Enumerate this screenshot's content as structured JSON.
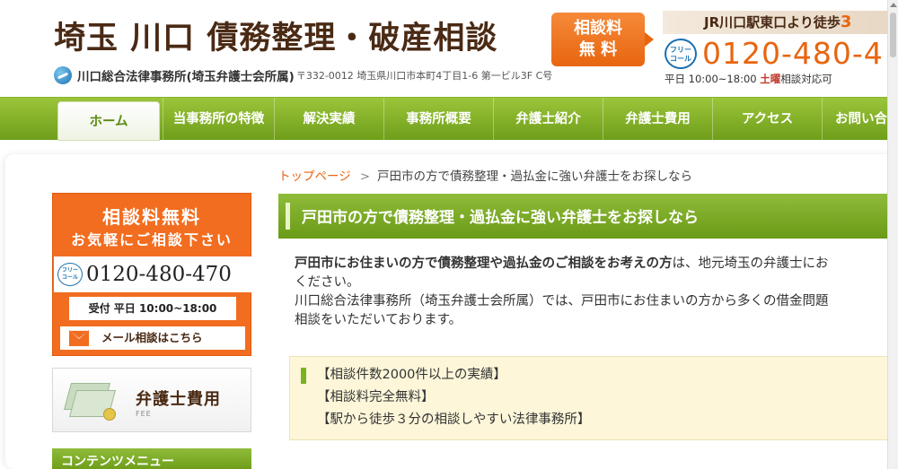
{
  "header": {
    "site_title": "埼玉 川口 債務整理・破産相談",
    "firm_name": "川口総合法律事務所(埼玉弁護士会所属)",
    "firm_address": "〒332-0012 埼玉県川口市本町4丁目1-6 第一ビル3F C号",
    "badge_line1": "相談料",
    "badge_line2": "無 料",
    "station_text": "JR川口駅東口より徒歩",
    "station_minutes": "3",
    "freecall_line1": "フリー",
    "freecall_line2": "コール",
    "phone": "0120-480-4",
    "hours_prefix": "平日 10:00~18:00 ",
    "hours_sat": "土曜",
    "hours_suffix": "相談対応可"
  },
  "nav": {
    "items": [
      {
        "label": "ホーム",
        "active": true
      },
      {
        "label": "当事務所の特徴"
      },
      {
        "label": "解決実績"
      },
      {
        "label": "事務所概要"
      },
      {
        "label": "弁護士紹介"
      },
      {
        "label": "弁護士費用"
      },
      {
        "label": "アクセス"
      },
      {
        "label": "お問い合"
      }
    ]
  },
  "sidebar": {
    "consult_title": "相談料無料",
    "consult_sub": "お気軽にご相談下さい",
    "consult_phone": "0120-480-470",
    "freecall_line1": "フリー",
    "freecall_line2": "コール",
    "consult_hours": "受付 平日 10:00~18:00",
    "mail_label": "メール相談はこちら",
    "fee_title": "弁護士費用",
    "fee_sub": "FEE",
    "menu_title": "コンテンツメニュー"
  },
  "breadcrumb": {
    "home": "トップページ",
    "separator": ">",
    "current": "戸田市の方で債務整理・過払金に強い弁護士をお探しなら"
  },
  "main": {
    "heading": "戸田市の方で債務整理・過払金に強い弁護士をお探しなら",
    "intro_bold": "戸田市にお住まいの方で債務整理や過払金のご相談をお考えの方",
    "intro_rest": "は、地元埼玉の弁護士にお",
    "intro_line2": "ください。",
    "intro_line3": "川口総合法律事務所（埼玉弁護士会所属）では、戸田市にお住まいの方から多くの借金問題",
    "intro_line4": "相談をいただいております。",
    "features": [
      "【相談件数2000件以上の実績】",
      "【相談料完全無料】",
      "【駅から徒歩３分の相談しやすい法律事務所】"
    ]
  },
  "colors": {
    "brand_green": "#7bb21f",
    "accent_orange": "#e8650f",
    "title_brown": "#4a2a14"
  }
}
